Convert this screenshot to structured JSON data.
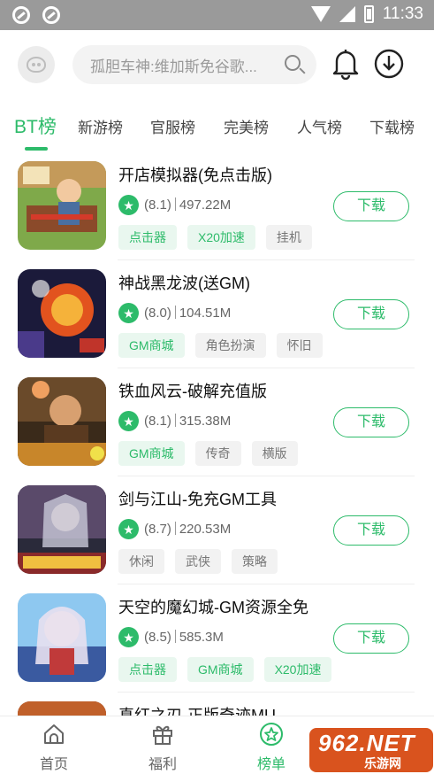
{
  "status_bar": {
    "time": "11:33"
  },
  "header": {
    "search_placeholder": "孤胆车神:维加斯免谷歌..."
  },
  "tabs": [
    {
      "label": "BT榜",
      "active": true
    },
    {
      "label": "新游榜",
      "active": false
    },
    {
      "label": "官服榜",
      "active": false
    },
    {
      "label": "完美榜",
      "active": false
    },
    {
      "label": "人气榜",
      "active": false
    },
    {
      "label": "下载榜",
      "active": false
    }
  ],
  "games": [
    {
      "title": "开店模拟器(免点击版)",
      "rating": "(8.1)",
      "size": "497.22M",
      "tags": [
        "点击器",
        "X20加速",
        "挂机"
      ],
      "button": "下载"
    },
    {
      "title": "神战黑龙波(送GM)",
      "rating": "(8.0)",
      "size": "104.51M",
      "tags": [
        "GM商城",
        "角色扮演",
        "怀旧"
      ],
      "button": "下载"
    },
    {
      "title": "铁血风云-破解充值版",
      "rating": "(8.1)",
      "size": "315.38M",
      "tags": [
        "GM商城",
        "传奇",
        "横版"
      ],
      "button": "下载"
    },
    {
      "title": "剑与江山-免充GM工具",
      "rating": "(8.7)",
      "size": "220.53M",
      "tags": [
        "休闲",
        "武侠",
        "策略"
      ],
      "button": "下载"
    },
    {
      "title": "天空的魔幻城-GM资源全免",
      "rating": "(8.5)",
      "size": "585.3M",
      "tags": [
        "点击器",
        "GM商城",
        "X20加速"
      ],
      "button": "下载"
    },
    {
      "title": "真红之刃-正版奇迹MU",
      "rating": "",
      "size": "",
      "tags": [],
      "button": ""
    }
  ],
  "bottom_nav": [
    {
      "label": "首页",
      "icon": "home-icon"
    },
    {
      "label": "福利",
      "icon": "gift-icon"
    },
    {
      "label": "榜单",
      "icon": "ranking-icon"
    }
  ],
  "watermark": {
    "main": "962.NET",
    "sub": "乐游网"
  },
  "colors": {
    "accent": "#2dbb6a",
    "status_bar": "#9a9a9a"
  }
}
